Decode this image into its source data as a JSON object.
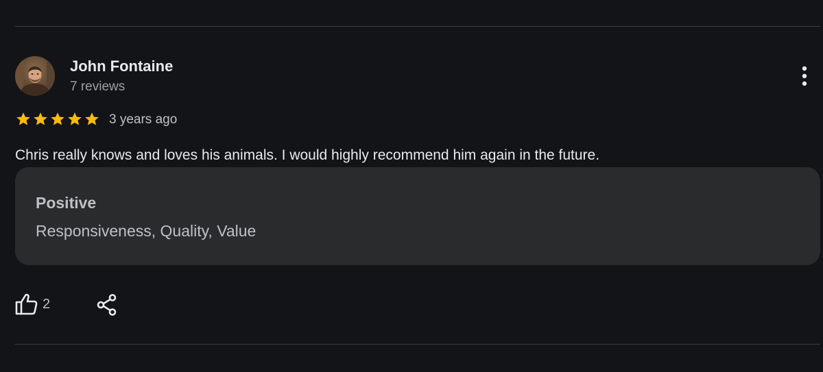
{
  "review": {
    "author": {
      "name": "John Fontaine",
      "review_count": "7 reviews",
      "avatar_icon": "profile-photo"
    },
    "rating": 5,
    "rating_max": 5,
    "date": "3 years ago",
    "text": "Chris really knows and loves his animals. I would highly recommend him again in the future.",
    "attributes": {
      "heading": "Positive",
      "values": "Responsiveness, Quality, Value"
    },
    "actions": {
      "like_count": "2",
      "like_icon": "thumbs-up-icon",
      "share_icon": "share-icon",
      "more_icon": "more-vert-icon"
    }
  },
  "colors": {
    "background": "#131417",
    "card_background": "#2a2b2d",
    "star": "#fbbc04",
    "primary_text": "#e8eaed",
    "secondary_text": "#9aa0a6",
    "divider": "#3c3d40"
  }
}
